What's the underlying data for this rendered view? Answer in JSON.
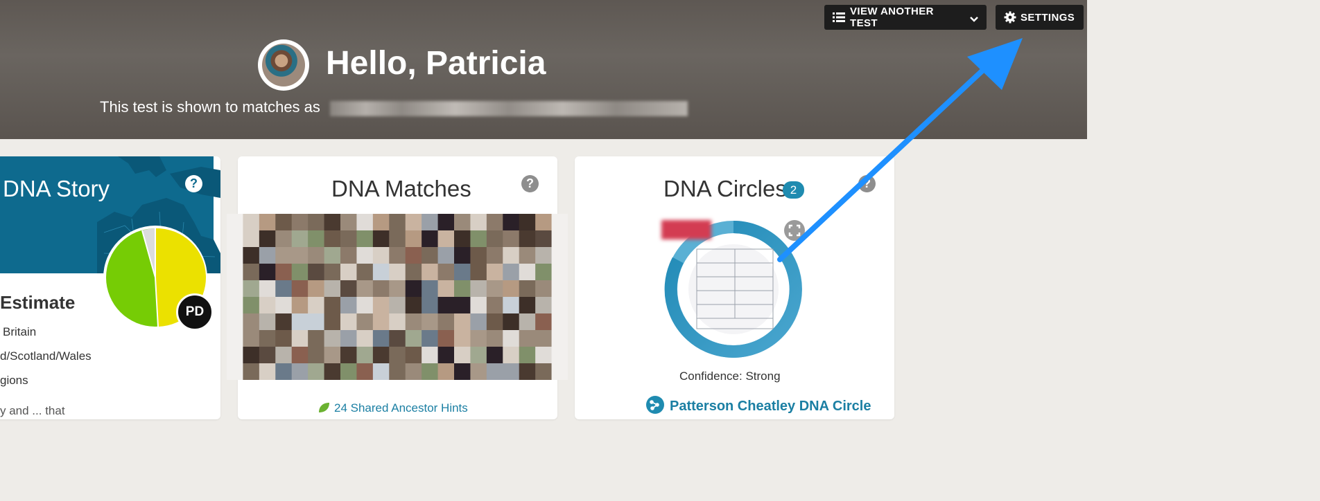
{
  "header": {
    "view_another_test_label": "VIEW ANOTHER TEST",
    "settings_label": "SETTINGS",
    "greeting": "Hello, Patricia",
    "shown_as_text": "This test is shown to matches as"
  },
  "dna_story": {
    "title": "DNA Story",
    "help": "?",
    "estimate_heading": "Estimate",
    "regions": [
      "Britain",
      "d/Scotland/Wales",
      "gions"
    ],
    "initials": "PD",
    "truncated_text": "y and ... that"
  },
  "dna_matches": {
    "title": "DNA Matches",
    "help": "?",
    "hints_link": "24 Shared Ancestor Hints"
  },
  "dna_circles": {
    "title": "DNA Circles",
    "count": "2",
    "help": "?",
    "confidence": "Confidence: Strong",
    "circle_link": "Patterson Cheatley DNA Circle"
  },
  "colors": {
    "link": "#1b7fa3",
    "accent_blue": "#1e90ff",
    "story_bg": "#0e6a8e",
    "pie_green": "#76cc05",
    "pie_yellow": "#ebe100"
  },
  "icons": {
    "list": "list-icon",
    "chevron": "chevron-down-icon",
    "gear": "gear-icon",
    "leaf": "leaf-icon",
    "expand": "expand-icon",
    "circle_share": "circle-network-icon"
  }
}
